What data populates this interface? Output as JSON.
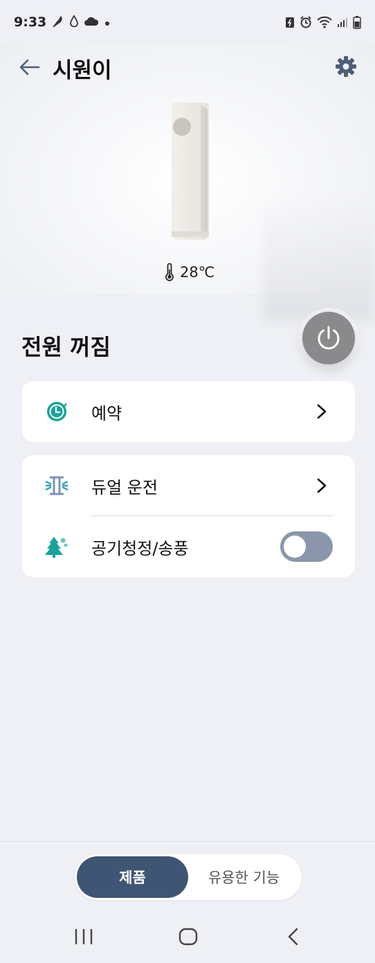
{
  "status_bar": {
    "time": "9:33",
    "left_icons": [
      "feather-icon",
      "drop-icon",
      "cloud-icon",
      "dot-icon"
    ],
    "right_icons": [
      "battery-saver-icon",
      "alarm-icon",
      "wifi-icon",
      "signal-icon",
      "battery-icon"
    ]
  },
  "header": {
    "title": "시원이",
    "back_icon": "arrow-left-icon",
    "settings_icon": "gear-icon"
  },
  "hero": {
    "temperature": "28℃",
    "temperature_icon": "thermometer-icon"
  },
  "power": {
    "status": "전원 꺼짐",
    "button_icon": "power-icon"
  },
  "cards": {
    "schedule": {
      "label": "예약",
      "icon": "clock-icon",
      "accent": "#1aa39a"
    },
    "dual": {
      "label": "듀얼 운전",
      "icon": "dual-operation-icon",
      "accent": "#5a8bd6"
    },
    "purify": {
      "label": "공기청정/송풍",
      "icon": "tree-icon",
      "accent": "#1aa39a",
      "toggle_on": false
    }
  },
  "bottom_tabs": {
    "active": "제품",
    "other": "유용한 기능",
    "active_color": "#3f5574"
  },
  "nav": {
    "recent_icon": "recent-apps-icon",
    "home_icon": "home-icon",
    "back_icon": "back-icon"
  }
}
